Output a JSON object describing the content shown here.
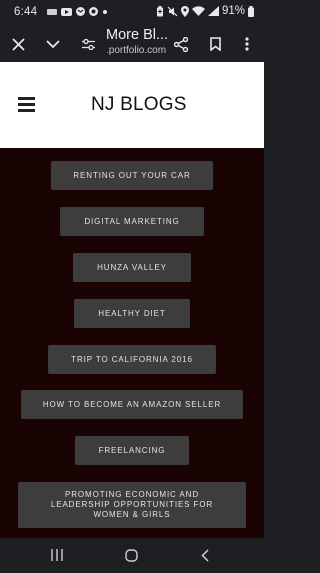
{
  "status_bar": {
    "time": "6:44",
    "battery_percent": "91%",
    "left_icons": [
      "sim-icon",
      "youtube-icon",
      "gmail-icon",
      "chat-icon",
      "dot-icon"
    ],
    "right_icons": [
      "battery-saver-icon",
      "mute-icon",
      "location-icon",
      "wifi-icon",
      "signal-icon",
      "battery-icon"
    ]
  },
  "browser": {
    "page_title": "More Bl...",
    "url_domain": "portfolio.com",
    "url_prefix": "."
  },
  "site": {
    "title": "NJ BLOGS"
  },
  "posts": [
    {
      "label": "RENTING OUT YOUR CAR"
    },
    {
      "label": "DIGITAL MARKETING"
    },
    {
      "label": "HUNZA VALLEY"
    },
    {
      "label": "HEALTHY DIET"
    },
    {
      "label": "TRIP TO CALIFORNIA 2016"
    },
    {
      "label": "HOW TO BECOME AN AMAZON SELLER"
    },
    {
      "label": "FREELANCING"
    },
    {
      "label": "PROMOTING ECONOMIC AND LEADERSHIP OPPORTUNITIES FOR WOMEN & GIRLS"
    }
  ],
  "colors": {
    "content_background": "#1a0403",
    "button_background": "#3d3d3d",
    "header_background": "#ffffff",
    "system_bar": "#1e1f22"
  }
}
